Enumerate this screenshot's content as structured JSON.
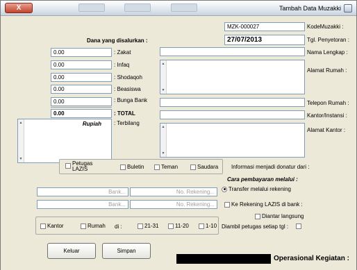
{
  "window": {
    "title": "Tambah Data Muzakki",
    "close_label": "X"
  },
  "fields": {
    "kode_label": "KodeMuzakki :",
    "kode_value": "MZK-000027",
    "tgl_label": "Tgl. Penyetoran :",
    "tgl_value": "27/07/2013",
    "nama_label": "Nama Lengkap :",
    "nama_value": "",
    "alamat_rumah_label": "Alamat Rumah :",
    "alamat_rumah_value": "",
    "telepon_label": "Telepon Rumah :",
    "telepon_value": "",
    "kantor_label": "Kantor/Instansi :",
    "kantor_value": "",
    "alamat_kantor_label": "Alamat Kantor :",
    "alamat_kantor_value": ""
  },
  "dana": {
    "header": "Dana yang disalurkan :",
    "items": [
      {
        "label": ": Zakat",
        "value": "0.00"
      },
      {
        "label": ": Infaq",
        "value": "0.00"
      },
      {
        "label": ": Shodaqoh",
        "value": "0.00"
      },
      {
        "label": ": Beasiswa",
        "value": "0.00"
      },
      {
        "label": ": Bunga Bank",
        "value": "0.00"
      }
    ],
    "total_label": ": TOTAL",
    "total_value": "0.00",
    "terbilang_label": ": Terbilang",
    "terbilang_value": "Rupiah"
  },
  "informasi": {
    "label": "Informasi menjadi donatur dari :",
    "options": [
      "Saudara",
      "Teman",
      "Buletin",
      "Petugas LAZIS"
    ]
  },
  "pembayaran": {
    "header": "Cara pembayaran melalui :",
    "transfer_label": "Transfer melalui rekening",
    "no_rek_placeholder": "No. Rekening...",
    "bank_placeholder": "Bank...",
    "ke_rekening_label": "Ke Rekening LAZIS di bank :",
    "diantar_label": "Diantar langsung",
    "diambil_label": "Diambil petugas setiap tgl :",
    "tgl_options": [
      "1-10",
      "11-20",
      "21-31"
    ],
    "di_label": "di :",
    "tempat_options": [
      "Rumah",
      "Kantor"
    ]
  },
  "buttons": {
    "simpan": "Simpan",
    "keluar": "Keluar"
  },
  "footer": {
    "operasional_label": "Operasional Kegiatan :"
  }
}
